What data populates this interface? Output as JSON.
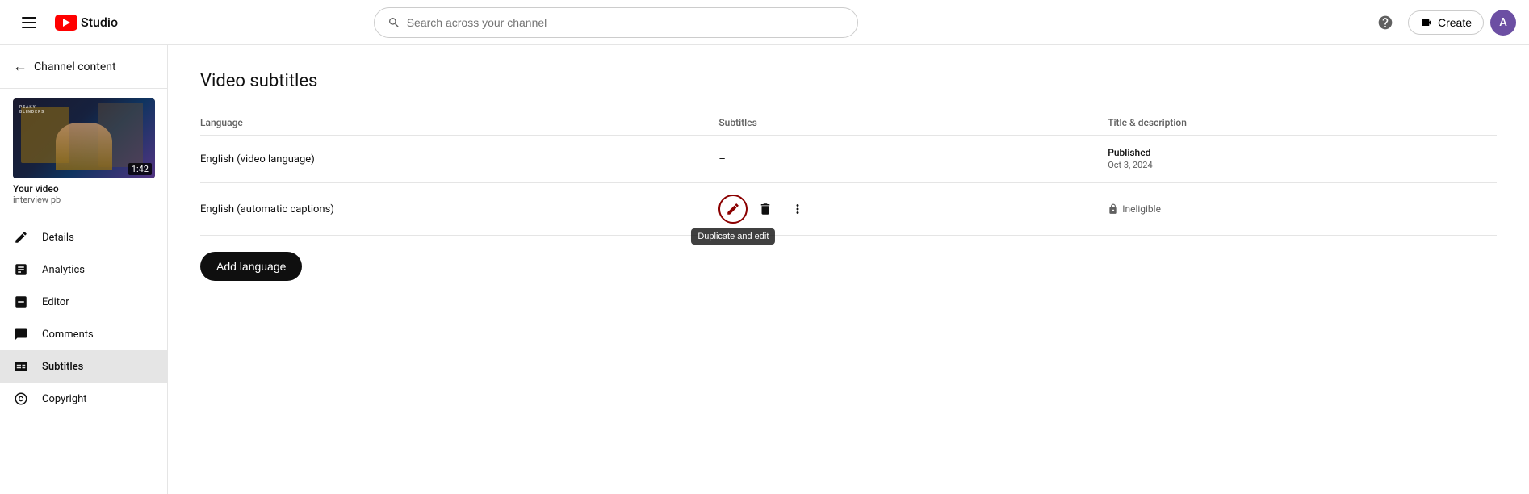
{
  "topnav": {
    "search_placeholder": "Search across your channel",
    "logo_text": "Studio",
    "create_label": "Create",
    "help_icon": "question-circle-icon",
    "avatar_letter": "A"
  },
  "sidebar": {
    "channel_header": "Channel content",
    "video": {
      "duration": "1:42",
      "title": "Your video",
      "subtitle": "interview pb"
    },
    "nav_items": [
      {
        "id": "details",
        "label": "Details",
        "icon": "pencil-icon"
      },
      {
        "id": "analytics",
        "label": "Analytics",
        "icon": "chart-icon"
      },
      {
        "id": "editor",
        "label": "Editor",
        "icon": "editor-icon"
      },
      {
        "id": "comments",
        "label": "Comments",
        "icon": "comments-icon"
      },
      {
        "id": "subtitles",
        "label": "Subtitles",
        "icon": "subtitles-icon",
        "active": true
      },
      {
        "id": "copyright",
        "label": "Copyright",
        "icon": "copyright-icon"
      }
    ]
  },
  "main": {
    "page_title": "Video subtitles",
    "table": {
      "columns": [
        "Language",
        "Subtitles",
        "Title & description"
      ],
      "rows": [
        {
          "language": "English (video language)",
          "subtitles": "–",
          "title_desc_status": "Published",
          "title_desc_date": "Oct 3, 2024"
        },
        {
          "language": "English (automatic captions)",
          "subtitles": "",
          "title_desc_status": "Ineligible"
        }
      ]
    },
    "add_language_label": "Add language",
    "duplicate_edit_tooltip": "Duplicate and edit"
  }
}
